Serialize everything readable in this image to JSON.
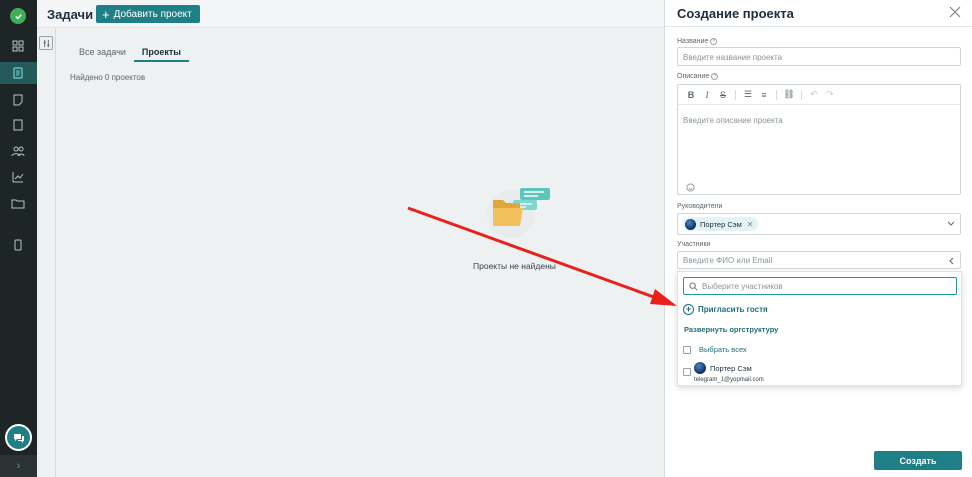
{
  "header": {
    "title": "Задачи",
    "add_project_label": "Добавить проект"
  },
  "tabs": [
    {
      "label": "Все задачи"
    },
    {
      "label": "Проекты",
      "active": true
    }
  ],
  "found_text": "Найдено 0 проектов",
  "empty_state": {
    "text": "Проекты не найдены",
    "icon": "folder-icon"
  },
  "sidebar": {
    "icons": [
      "dashboard-icon",
      "tasks-icon",
      "notes-icon",
      "document-icon",
      "users-icon",
      "chart-icon",
      "folder-icon",
      "phone-icon"
    ],
    "active_index": 1
  },
  "drawer": {
    "title": "Создание проекта",
    "name_label": "Название",
    "name_placeholder": "Введите название проекта",
    "description_label": "Описание",
    "description_placeholder": "Введите описание проекта",
    "managers_label": "Руководители",
    "manager_chip": "Портер Сэм",
    "participants_label": "Участники",
    "participants_placeholder": "Введите ФИО или Email",
    "dropdown": {
      "search_placeholder": "Выберите участников",
      "invite_guest": "Пригласить гостя",
      "expand_org": "Развернуть оргструктуру",
      "select_all": "Выбрать всех",
      "users": [
        {
          "name": "Портер Сэм",
          "email": "telegram_1@yopmail.com"
        }
      ]
    },
    "create_label": "Создать"
  },
  "colors": {
    "accent": "#1e7f86",
    "sidebar": "#1d2526",
    "arrow": "#e8221b"
  }
}
